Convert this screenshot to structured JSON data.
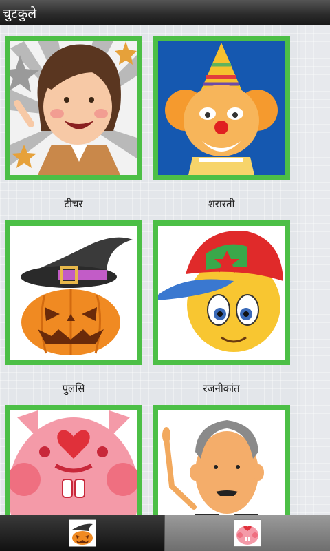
{
  "app": {
    "title": "चुटकुले"
  },
  "tiles": [
    {
      "label": "टीचर"
    },
    {
      "label": "शरारती"
    },
    {
      "label": "पुलसि"
    },
    {
      "label": "रजनीकांत"
    }
  ],
  "colors": {
    "frame": "#4cbf46",
    "background": "#e3e6ea",
    "statusbar": "#2a2a2a"
  },
  "tabs": [
    {
      "icon": "pumpkin-icon",
      "active": false
    },
    {
      "icon": "pink-bunny-icon",
      "active": true
    }
  ]
}
